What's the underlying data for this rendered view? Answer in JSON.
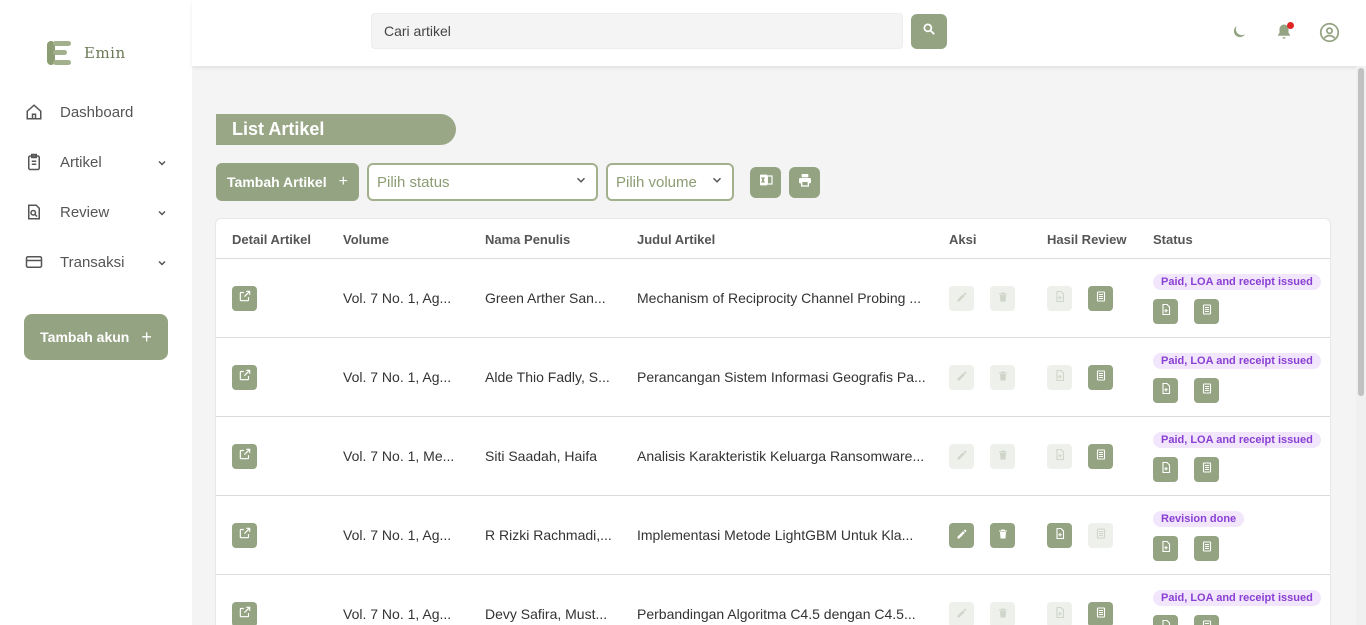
{
  "brand": {
    "name": "Emin"
  },
  "sidebar": {
    "items": [
      {
        "label": "Dashboard",
        "icon": "home-icon",
        "has_chevron": false
      },
      {
        "label": "Artikel",
        "icon": "clipboard-icon",
        "has_chevron": true
      },
      {
        "label": "Review",
        "icon": "review-search-icon",
        "has_chevron": true
      },
      {
        "label": "Transaksi",
        "icon": "credit-card-icon",
        "has_chevron": true
      }
    ],
    "add_account_label": "Tambah akun",
    "add_account_symbol": "+"
  },
  "header": {
    "search_placeholder": "Cari artikel",
    "icons": [
      "moon-icon",
      "bell-icon",
      "user-circle-icon"
    ]
  },
  "main": {
    "title": "List Artikel",
    "add_article_label": "Tambah Artikel",
    "add_article_symbol": "+",
    "status_select": "Pilih status",
    "volume_select": "Pilih volume"
  },
  "colors": {
    "accent": "#94a382",
    "badge_text": "#8a3fd4",
    "badge_bg": "#f1e6fb",
    "notif": "#e02424"
  },
  "table": {
    "headers": [
      "Detail Artikel",
      "Volume",
      "Nama Penulis",
      "Judul Artikel",
      "Aksi",
      "Hasil Review",
      "Status"
    ],
    "rows": [
      {
        "volume": "Vol. 7 No. 1, Ag...",
        "author": "Green Arther San...",
        "title": "Mechanism of Reciprocity Channel Probing ...",
        "actions_enabled": false,
        "review_file_enabled": false,
        "review_doc_enabled": true,
        "status": "Paid, LOA and receipt issued"
      },
      {
        "volume": "Vol. 7 No. 1, Ag...",
        "author": "Alde Thio Fadly, S...",
        "title": "Perancangan Sistem Informasi Geografis Pa...",
        "actions_enabled": false,
        "review_file_enabled": false,
        "review_doc_enabled": true,
        "status": "Paid, LOA and receipt issued"
      },
      {
        "volume": "Vol. 7 No. 1, Me...",
        "author": "Siti Saadah, Haifa",
        "title": "Analisis Karakteristik Keluarga Ransomware...",
        "actions_enabled": false,
        "review_file_enabled": false,
        "review_doc_enabled": true,
        "status": "Paid, LOA and receipt issued"
      },
      {
        "volume": "Vol. 7 No. 1, Ag...",
        "author": "R Rizki Rachmadi,...",
        "title": "Implementasi Metode LightGBM Untuk Kla...",
        "actions_enabled": true,
        "review_file_enabled": true,
        "review_doc_enabled": false,
        "status": "Revision done"
      },
      {
        "volume": "Vol. 7 No. 1, Ag...",
        "author": "Devy Safira, Must...",
        "title": "Perbandingan Algoritma C4.5 dengan C4.5...",
        "actions_enabled": false,
        "review_file_enabled": false,
        "review_doc_enabled": true,
        "status": "Paid, LOA and receipt issued"
      }
    ]
  }
}
